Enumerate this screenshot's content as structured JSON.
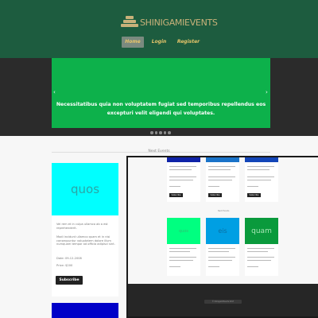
{
  "header": {
    "logo_text": "SHINIGAMIEVENTS",
    "nav": [
      {
        "label": "Home",
        "active": true
      },
      {
        "label": "Login",
        "active": false
      },
      {
        "label": "Register",
        "active": false
      }
    ]
  },
  "hero": {
    "slide_text": "Necessitatibus quia non voluptatem fugiat sed temporibus repellendus eos excepturi velit eligendi qui voluptates.",
    "slide_color": "#0db14b",
    "dot_count": 5
  },
  "section": {
    "title": "Next Events"
  },
  "event_main": {
    "image_word": "quos",
    "image_color": "#00ffff",
    "paragraphs": [
      "Vel rem et in culpa ullamco ab a est reprehenderit.",
      "Modi incidunt ullamco quam et in nisi consequuntur voluptatem dolore illum numquam tempor ad officia adipisci sint.",
      "Date: 09-12-2008",
      "Price: $200"
    ],
    "subscribe_label": "Subscribe"
  },
  "inset": {
    "top_cards": [
      {
        "color": "#0f23a8",
        "button": "Subscribe"
      },
      {
        "color": "#1a73c9",
        "button": "Subscribe"
      },
      {
        "color": "#1346b8",
        "button": "Subscribe"
      }
    ],
    "section_label": "Next Events",
    "mid_cards": [
      {
        "color": "#00ff80",
        "word": "quos"
      },
      {
        "color": "#009fe3",
        "word": "eis"
      },
      {
        "color": "#0a9a3c",
        "word": "quam"
      }
    ],
    "footer_text": "© ShinigamiEvents 2017"
  }
}
